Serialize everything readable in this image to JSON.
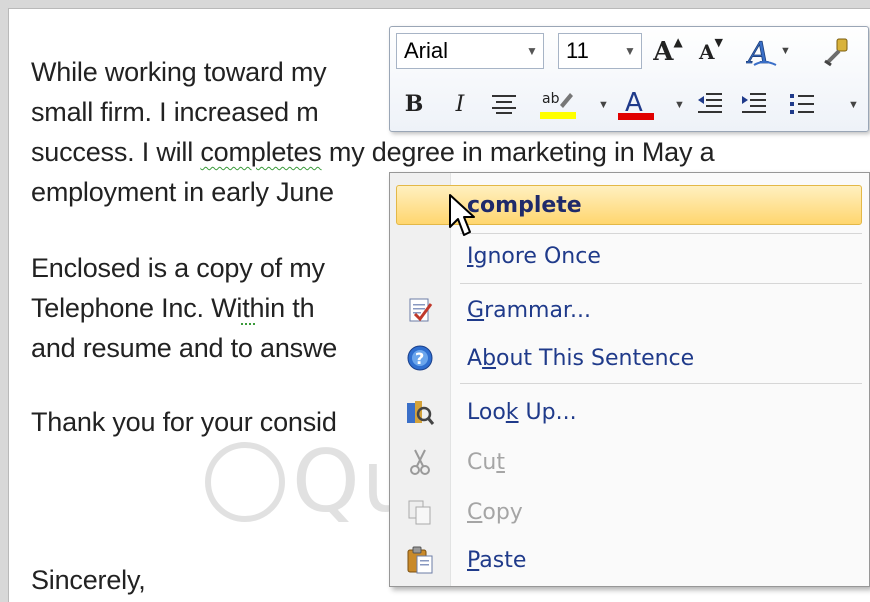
{
  "document": {
    "lines": [
      "While working toward my",
      "small firm.  I increased m",
      "success. I will ",
      "completes",
      " my degree in marketing in May a",
      "employment in early June",
      "Enclosed is  a copy of my",
      "Telephone Inc.",
      "  Within th",
      "and resume and to answe",
      "Thank you for your consid",
      "Sincerely,"
    ]
  },
  "minibar": {
    "font_name": "Arial",
    "font_size": "11",
    "grow_font": "A",
    "shrink_font": "A",
    "bold": "B",
    "italic": "I",
    "font_color": "A"
  },
  "context_menu": {
    "suggestion": "complete",
    "ignore_once": {
      "pre": "",
      "accel": "I",
      "post": "gnore Once"
    },
    "grammar": {
      "pre": "",
      "accel": "G",
      "post": "rammar..."
    },
    "about": {
      "pre": "A",
      "accel": "b",
      "post": "out This Sentence"
    },
    "lookup": {
      "pre": "Loo",
      "accel": "k",
      "post": " Up..."
    },
    "cut": {
      "pre": "Cu",
      "accel": "t",
      "post": ""
    },
    "copy": {
      "pre": "",
      "accel": "C",
      "post": "opy"
    },
    "paste": {
      "pre": "",
      "accel": "P",
      "post": "aste"
    }
  },
  "colors": {
    "highlight": "#ffd66f",
    "font_color_bar": "#e00000",
    "highlight_bar": "#ffff00",
    "menu_text": "#1f3a8a"
  },
  "watermark": "Quantrimang"
}
